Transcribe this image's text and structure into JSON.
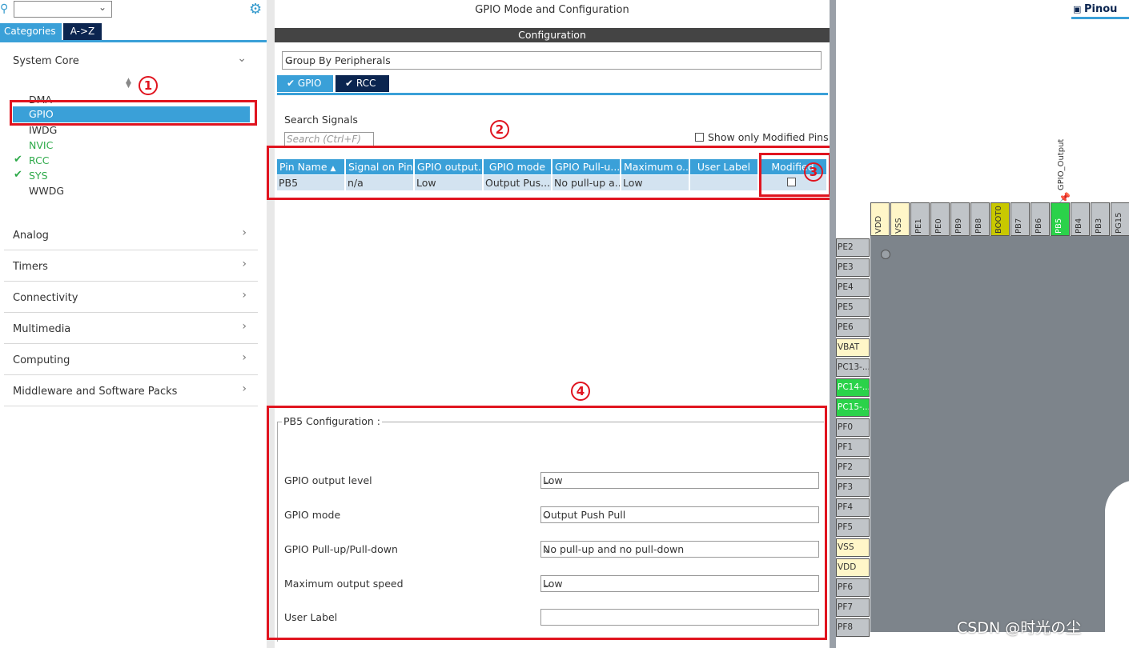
{
  "left_panel": {
    "tabs": {
      "categories": "Categories",
      "az": "A->Z"
    },
    "sections": [
      {
        "label": "System Core",
        "expanded": true
      },
      {
        "label": "Analog"
      },
      {
        "label": "Timers"
      },
      {
        "label": "Connectivity"
      },
      {
        "label": "Multimedia"
      },
      {
        "label": "Computing"
      },
      {
        "label": "Middleware and Software Packs"
      }
    ],
    "peripherals": [
      {
        "label": "DMA",
        "color": "#333333",
        "checked": false
      },
      {
        "label": "GPIO",
        "color": "#ffffff",
        "checked": false,
        "selected": true
      },
      {
        "label": "IWDG",
        "color": "#333333",
        "checked": false
      },
      {
        "label": "NVIC",
        "color": "#2eaa4a",
        "checked": false
      },
      {
        "label": "RCC",
        "color": "#2eaa4a",
        "checked": true
      },
      {
        "label": "SYS",
        "color": "#2eaa4a",
        "checked": true
      },
      {
        "label": "WWDG",
        "color": "#333333",
        "checked": false
      }
    ]
  },
  "mode": {
    "title": "GPIO Mode and Configuration",
    "config_bar": "Configuration",
    "group_select": "Group By Peripherals",
    "tabs": [
      "GPIO",
      "RCC"
    ],
    "search_label": "Search Signals",
    "search_placeholder": "Search (Ctrl+F)",
    "show_modified": "Show only Modified Pins"
  },
  "table": {
    "headers": [
      "Pin Name",
      "Signal on Pin",
      "GPIO output...",
      "GPIO mode",
      "GPIO Pull-u...",
      "Maximum o...",
      "User Label",
      "Modified"
    ],
    "rows": [
      [
        "PB5",
        "n/a",
        "Low",
        "Output Pus...",
        "No pull-up a...",
        "Low",
        "",
        ""
      ]
    ]
  },
  "config": {
    "title": "PB5 Configuration :",
    "fields": [
      {
        "label": "GPIO output level",
        "value": "Low"
      },
      {
        "label": "GPIO mode",
        "value": "Output Push Pull"
      },
      {
        "label": "GPIO Pull-up/Pull-down",
        "value": "No pull-up and no pull-down"
      },
      {
        "label": "Maximum output speed",
        "value": "Low"
      },
      {
        "label": "User Label",
        "value": ""
      }
    ]
  },
  "annotations": [
    "1",
    "2",
    "3",
    "4"
  ],
  "pinout": {
    "tab": "Pinou",
    "gpio_output_label": "GPIO_Output",
    "top_pins": [
      "VDD",
      "VSS",
      "PE1",
      "PE0",
      "PB9",
      "PB8",
      "BOOT0",
      "PB7",
      "PB6",
      "PB5",
      "PB4",
      "PB3",
      "PG15"
    ],
    "left_pins": [
      "PE2",
      "PE3",
      "PE4",
      "PE5",
      "PE6",
      "VBAT",
      "PC13-...",
      "PC14-...",
      "PC15-...",
      "PF0",
      "PF1",
      "PF2",
      "PF3",
      "PF4",
      "PF5",
      "VSS",
      "VDD",
      "PF6",
      "PF7",
      "PF8"
    ]
  },
  "watermark": "CSDN @时光の尘"
}
